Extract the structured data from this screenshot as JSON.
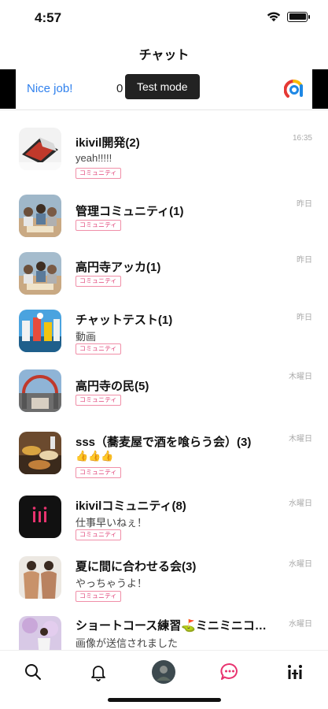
{
  "status_bar": {
    "time": "4:57"
  },
  "header": {
    "title": "チャット"
  },
  "ad": {
    "nice_label": "Nice job!",
    "text": "0 test ad.",
    "tooltip": "Test mode"
  },
  "chats": [
    {
      "name": "ikivil開発(2)",
      "preview": "yeah!!!!!",
      "tag": "コミュニティ",
      "time": "16:35"
    },
    {
      "name": "管理コミュニティ(1)",
      "preview": "",
      "tag": "コミュニティ",
      "time": "昨日"
    },
    {
      "name": "高円寺アッカ(1)",
      "preview": "",
      "tag": "コミュニティ",
      "time": "昨日"
    },
    {
      "name": "チャットテスト(1)",
      "preview": "動画",
      "tag": "コミュニティ",
      "time": "昨日"
    },
    {
      "name": "高円寺の民(5)",
      "preview": "",
      "tag": "コミュニティ",
      "time": "木曜日"
    },
    {
      "name": "sss（蕎麦屋で酒を喰らう会）(3)",
      "preview": "👍👍👍",
      "tag": "コミュニティ",
      "time": "木曜日"
    },
    {
      "name": "ikivilコミュニティ(8)",
      "preview": "仕事早いねぇ！",
      "tag": "コミュニティ",
      "time": "水曜日"
    },
    {
      "name": "夏に間に合わせる会(3)",
      "preview": "やっちゃうよ！",
      "tag": "コミュニティ",
      "time": "水曜日"
    },
    {
      "name": "ショートコース練習⛳ミニミニコ…",
      "preview": "画像が送信されました",
      "tag": "",
      "time": "水曜日"
    }
  ],
  "tab_bar": {
    "items": [
      "search-icon",
      "bell-icon",
      "profile-avatar",
      "chat-bubble-icon",
      "ikivil-logo-icon"
    ],
    "active": "chat-bubble-icon",
    "accent_color": "#e8336f"
  }
}
